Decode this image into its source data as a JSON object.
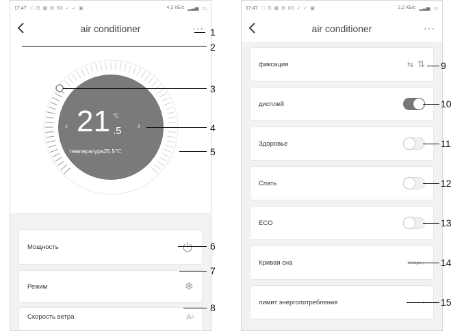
{
  "left_screen": {
    "status": {
      "time": "17:47",
      "icons": "□ ⊟ ▦ ⊞ 88 ✓ ✓ ▣",
      "speed": "4,3 КБ/c"
    },
    "title": "air conditioner",
    "more": "···",
    "temperature": {
      "value": "21",
      "decimal": ".5",
      "unit": "℃",
      "set_label": "температура25.5℃"
    },
    "cards": [
      {
        "label": "Мощность",
        "icon": "power-icon"
      },
      {
        "label": "Режим",
        "icon": "snowflake-icon"
      },
      {
        "label": "Скорость ветра",
        "icon": "fan-speed-icon"
      }
    ]
  },
  "right_screen": {
    "status": {
      "time": "17:47",
      "icons": "□ ⊟ ▦ ⊞ 88 ✓ ✓ ▣",
      "speed": "3,2 КБ/c"
    },
    "title": "air conditioner",
    "more": "···",
    "rows": [
      {
        "label": "фиксация",
        "kind": "swing"
      },
      {
        "label": "дисплей",
        "kind": "toggle",
        "on": true
      },
      {
        "label": "Здоровье",
        "kind": "toggle",
        "on": false
      },
      {
        "label": "Спать",
        "kind": "toggle",
        "on": false
      },
      {
        "label": "ECO",
        "kind": "toggle",
        "on": false
      },
      {
        "label": "Кривая сна",
        "kind": "value",
        "value": "Ожида"
      },
      {
        "label": "лимит энергопотребления",
        "kind": "chevron",
        "chevron": "›"
      }
    ]
  },
  "callouts": [
    "1",
    "2",
    "3",
    "4",
    "5",
    "6",
    "7",
    "8",
    "9",
    "10",
    "11",
    "12",
    "13",
    "14",
    "15"
  ]
}
